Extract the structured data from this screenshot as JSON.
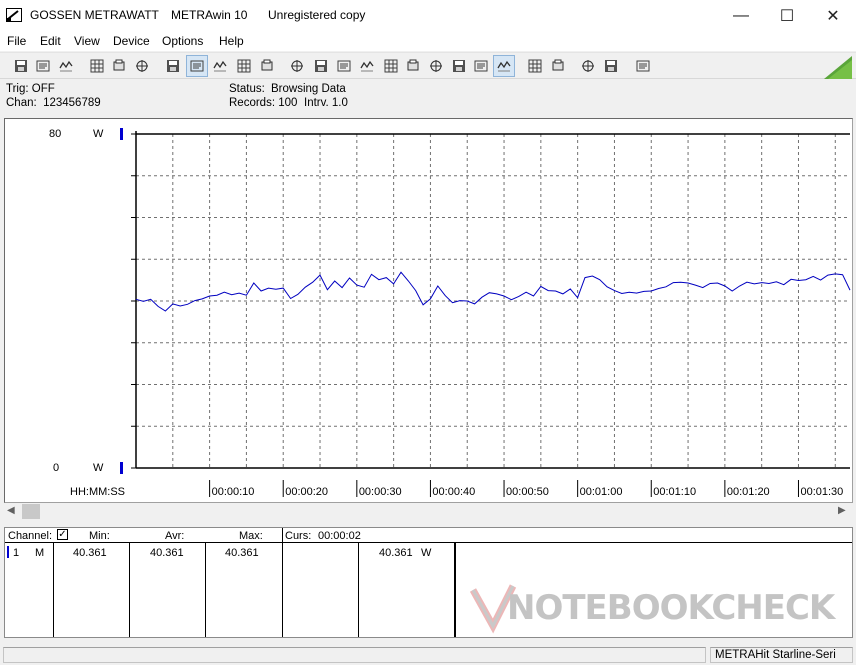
{
  "window": {
    "brand": "GOSSEN METRAWATT",
    "app": "METRAwin 10",
    "license": "Unregistered copy",
    "minimize": "—",
    "maximize": "☐",
    "close": "✕"
  },
  "menu": [
    "File",
    "Edit",
    "View",
    "Device",
    "Options",
    "Help"
  ],
  "status": {
    "trig": "Trig: OFF",
    "chan": "Chan:  123456789",
    "status_label": "Status:",
    "status_value": "Browsing Data",
    "records": "Records: 100",
    "interval": "Intrv. 1.0"
  },
  "chart": {
    "y_top_label": "80",
    "y_bottom_label": "0",
    "unit_top": "W",
    "unit_bottom": "W",
    "x_axis_label": "HH:MM:SS",
    "x_ticks": [
      "00:00:10",
      "00:00:20",
      "00:00:30",
      "00:00:40",
      "00:00:50",
      "00:01:00",
      "00:01:10",
      "00:01:20",
      "00:01:30"
    ]
  },
  "chart_data": {
    "type": "line",
    "xlabel": "HH:MM:SS",
    "ylabel": "W",
    "ylim": [
      0,
      80
    ],
    "xlim": [
      0,
      97
    ],
    "grid": true,
    "series": [
      {
        "color": "#0000c0",
        "x": [
          0,
          1,
          2,
          3,
          4,
          5,
          6,
          7,
          8,
          9,
          10,
          11,
          12,
          13,
          14,
          15,
          16,
          17,
          18,
          19,
          20,
          21,
          22,
          23,
          24,
          25,
          26,
          27,
          28,
          29,
          30,
          31,
          32,
          33,
          34,
          35,
          36,
          37,
          38,
          39,
          40,
          41,
          42,
          43,
          44,
          45,
          46,
          47,
          48,
          49,
          50,
          51,
          52,
          53,
          54,
          55,
          56,
          57,
          58,
          59,
          60,
          61,
          62,
          63,
          64,
          65,
          66,
          67,
          68,
          69,
          70,
          71,
          72,
          73,
          74,
          75,
          76,
          77,
          78,
          79,
          80,
          81,
          82,
          83,
          84,
          85,
          86,
          87,
          88,
          89,
          90,
          91,
          92,
          93,
          94,
          95,
          96,
          97
        ],
        "values": [
          40.4,
          39.9,
          40.4,
          38.7,
          37.6,
          39.3,
          38.8,
          39.2,
          40.1,
          40.5,
          41.2,
          41.4,
          42.1,
          41.5,
          41.9,
          41.4,
          44.3,
          42.4,
          43.1,
          42.8,
          43.1,
          40.6,
          41.6,
          43.3,
          44.5,
          46.2,
          42.7,
          44.8,
          43.2,
          45.5,
          43.8,
          43.3,
          46.4,
          45.1,
          45.6,
          44.1,
          46.9,
          44.8,
          42.5,
          39.1,
          40.5,
          43.6,
          41.3,
          39.6,
          40.1,
          40.0,
          39.3,
          40.9,
          42.0,
          41.7,
          41.2,
          40.3,
          41.1,
          42.1,
          41.2,
          43.5,
          42.5,
          42.4,
          41.7,
          42.9,
          40.8,
          45.6,
          46.0,
          45.1,
          43.4,
          42.5,
          41.8,
          42.1,
          41.9,
          42.3,
          42.4,
          43.0,
          43.4,
          44.4,
          44.5,
          44.3,
          43.8,
          43.2,
          44.2,
          44.3,
          43.6,
          42.4,
          43.6,
          44.5,
          44.1,
          44.4,
          44.2,
          44.6,
          43.9,
          45.2,
          44.9,
          45.1,
          45.9,
          45.0,
          46.2,
          46.5,
          46.3,
          42.6
        ]
      }
    ]
  },
  "table": {
    "header": {
      "channel": "Channel:",
      "min": "Min:",
      "avr": "Avr:",
      "max": "Max:",
      "curs": "Curs:",
      "curs_time": "00:00:02"
    },
    "row": {
      "num": "1",
      "mode": "M",
      "min": "40.361",
      "avr": "40.361",
      "max": "40.361",
      "value": "40.361",
      "unit": "W"
    }
  },
  "watermark": "NOTEBOOKCHECK",
  "statusbar": {
    "device": "METRAHit Starline-Seri"
  },
  "toolbar_icons": [
    "save-icon",
    "save-as-icon",
    "open-folder-icon",
    "device-read-icon",
    "device-write-icon",
    "device-config-icon",
    "table-view-icon",
    "chart-view-icon",
    "crosshair-icon",
    "grid-icon",
    "bar-chart-icon",
    "export-icon",
    "import-icon",
    "list-icon",
    "computer-icon",
    "formula-icon",
    "signal-icon",
    "wave-icon",
    "sine-icon",
    "scan-icon",
    "smile-icon",
    "print-preview-icon",
    "print-icon",
    "zoom-wave-icon",
    "zoom-icon",
    "comment-icon"
  ]
}
